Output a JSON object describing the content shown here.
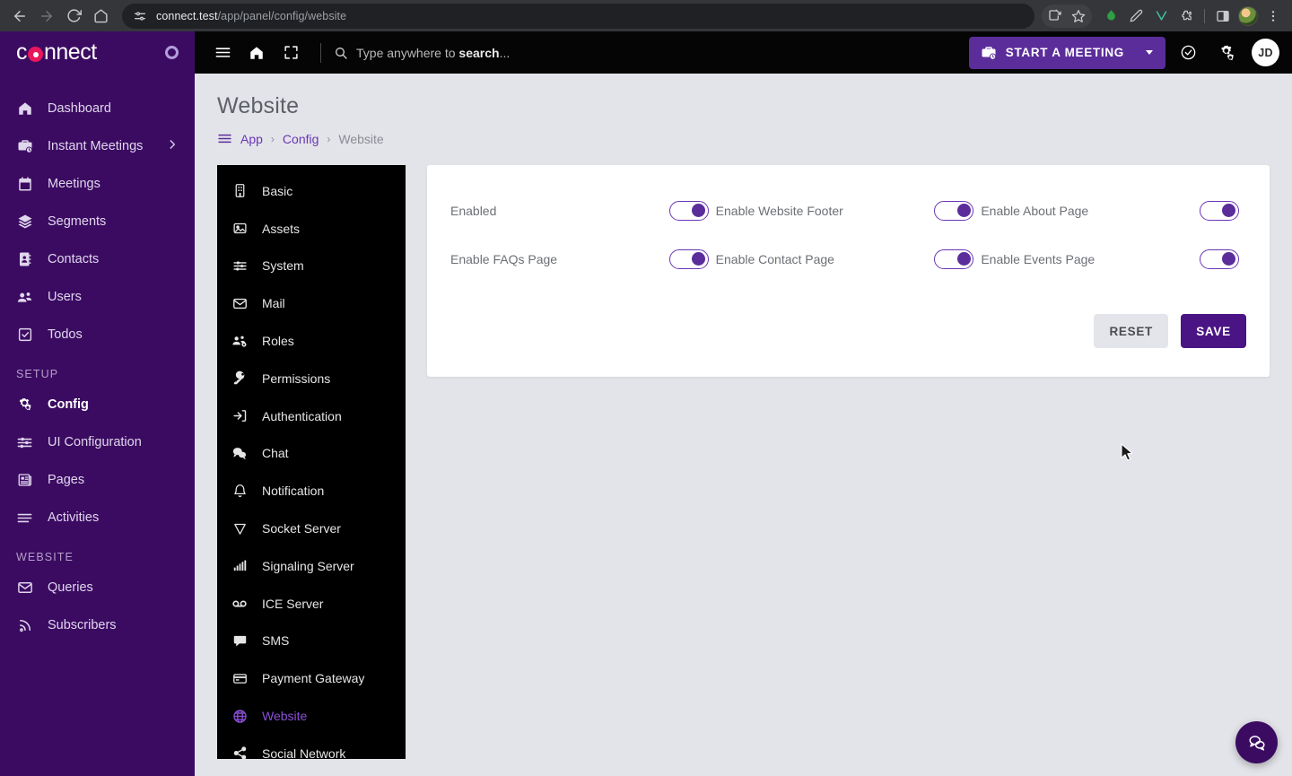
{
  "browser": {
    "url_domain": "connect.test",
    "url_path": "/app/panel/config/website",
    "back_icon": "back-arrow-icon",
    "forward_icon": "forward-arrow-icon",
    "reload_icon": "reload-icon",
    "home_icon": "home-icon",
    "site_info_icon": "site-settings-icon",
    "extensions": [
      {
        "name": "install-app-icon"
      },
      {
        "name": "bookmark-star-icon"
      },
      {
        "name": "extension-green-icon"
      },
      {
        "name": "extension-pen-icon"
      },
      {
        "name": "extension-v-icon"
      },
      {
        "name": "extensions-puzzle-icon"
      },
      {
        "name": "side-panel-icon"
      },
      {
        "name": "profile-avatar-icon"
      },
      {
        "name": "chrome-menu-icon"
      }
    ]
  },
  "sidebar": {
    "brand": {
      "text_before": "c",
      "text_after": "nnect",
      "dot_icon": "brand-target-icon"
    },
    "items": [
      {
        "label": "Dashboard",
        "icon": "home-icon",
        "active": false,
        "expandable": false
      },
      {
        "label": "Instant Meetings",
        "icon": "briefcase-clock-icon",
        "active": false,
        "expandable": true
      },
      {
        "label": "Meetings",
        "icon": "calendar-icon",
        "active": false,
        "expandable": false
      },
      {
        "label": "Segments",
        "icon": "layers-icon",
        "active": false,
        "expandable": false
      },
      {
        "label": "Contacts",
        "icon": "contact-book-icon",
        "active": false,
        "expandable": false
      },
      {
        "label": "Users",
        "icon": "users-icon",
        "active": false,
        "expandable": false
      },
      {
        "label": "Todos",
        "icon": "checkbox-icon",
        "active": false,
        "expandable": false
      }
    ],
    "section_setup": "SETUP",
    "setup_items": [
      {
        "label": "Config",
        "icon": "gears-icon",
        "active": true
      },
      {
        "label": "UI Configuration",
        "icon": "sliders-icon",
        "active": false
      },
      {
        "label": "Pages",
        "icon": "article-icon",
        "active": false
      },
      {
        "label": "Activities",
        "icon": "list-icon",
        "active": false
      }
    ],
    "section_website": "WEBSITE",
    "website_items": [
      {
        "label": "Queries",
        "icon": "envelope-icon",
        "active": false
      },
      {
        "label": "Subscribers",
        "icon": "rss-icon",
        "active": false
      }
    ]
  },
  "topbar": {
    "menu_icon": "hamburger-menu-icon",
    "home_icon": "home-icon",
    "fullscreen_icon": "fullscreen-icon",
    "search_icon": "search-icon",
    "search_placeholder_prefix": "Type anywhere to ",
    "search_placeholder_bold": "search",
    "search_placeholder_suffix": "...",
    "start_meeting_label": "START A MEETING",
    "start_meeting_icon": "briefcase-clock-icon",
    "check_icon": "check-circle-icon",
    "settings_icon": "gears-icon",
    "avatar_initials": "JD"
  },
  "page": {
    "title": "Website",
    "breadcrumb_icon": "hamburger-menu-icon",
    "breadcrumb": [
      {
        "label": "App",
        "link": true
      },
      {
        "label": "Config",
        "link": true
      },
      {
        "label": "Website",
        "link": false
      }
    ],
    "breadcrumb_separator": "›"
  },
  "config_menu": {
    "items": [
      {
        "label": "Basic",
        "icon": "building-icon",
        "active": false
      },
      {
        "label": "Assets",
        "icon": "image-icon",
        "active": false
      },
      {
        "label": "System",
        "icon": "sliders-icon",
        "active": false
      },
      {
        "label": "Mail",
        "icon": "envelope-icon",
        "active": false
      },
      {
        "label": "Roles",
        "icon": "users-gear-icon",
        "active": false
      },
      {
        "label": "Permissions",
        "icon": "key-icon",
        "active": false
      },
      {
        "label": "Authentication",
        "icon": "sign-in-icon",
        "active": false
      },
      {
        "label": "Chat",
        "icon": "chat-bubbles-icon",
        "active": false
      },
      {
        "label": "Notification",
        "icon": "bell-icon",
        "active": false
      },
      {
        "label": "Socket Server",
        "icon": "socket-icon",
        "active": false
      },
      {
        "label": "Signaling Server",
        "icon": "signal-bars-icon",
        "active": false
      },
      {
        "label": "ICE Server",
        "icon": "voicemail-icon",
        "active": false
      },
      {
        "label": "SMS",
        "icon": "message-icon",
        "active": false
      },
      {
        "label": "Payment Gateway",
        "icon": "credit-card-icon",
        "active": false
      },
      {
        "label": "Website",
        "icon": "globe-icon",
        "active": true
      },
      {
        "label": "Social Network",
        "icon": "share-icon",
        "active": false
      }
    ]
  },
  "settings_card": {
    "toggles": [
      {
        "label": "Enabled",
        "value": "on"
      },
      {
        "label": "Enable Website Footer",
        "value": "on"
      },
      {
        "label": "Enable About Page",
        "value": "on"
      },
      {
        "label": "Enable FAQs Page",
        "value": "on"
      },
      {
        "label": "Enable Contact Page",
        "value": "on"
      },
      {
        "label": "Enable Events Page",
        "value": "on"
      }
    ],
    "reset_label": "RESET",
    "save_label": "SAVE"
  },
  "fab": {
    "icon": "chat-bubbles-icon"
  },
  "colors": {
    "sidebar_purple": "#3b0b62",
    "accent_purple": "#5b2d9b",
    "link_purple": "#6b35b5",
    "active_menu_purple": "#8a4fd6",
    "save_purple": "#4b1485",
    "brand_pink": "#e8175d",
    "content_bg": "#e3e4e9",
    "panel_black": "#000000"
  }
}
